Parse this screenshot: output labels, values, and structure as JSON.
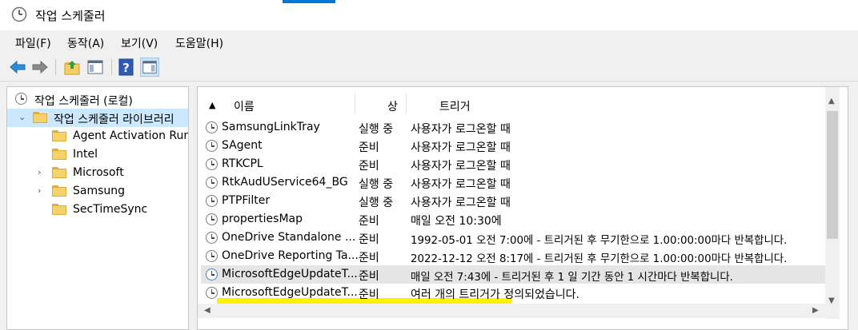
{
  "window": {
    "title": "작업 스케줄러"
  },
  "menu": [
    {
      "label": "파일(F)"
    },
    {
      "label": "동작(A)"
    },
    {
      "label": "보기(V)"
    },
    {
      "label": "도움말(H)"
    }
  ],
  "toolbar": {
    "buttons": [
      "back-arrow-icon",
      "forward-arrow-icon",
      "up-folder-icon",
      "show-hide-console-tree-icon",
      "help-icon",
      "show-hide-action-pane-icon"
    ]
  },
  "tree": {
    "root": "작업 스케줄러 (로컬)",
    "library": "작업 스케줄러 라이브러리",
    "folders": [
      {
        "label": "Agent Activation Runt"
      },
      {
        "label": "Intel"
      },
      {
        "label": "Microsoft"
      },
      {
        "label": "Samsung"
      },
      {
        "label": "SecTimeSync"
      }
    ]
  },
  "table": {
    "columns": {
      "name": "이름",
      "status": "상",
      "trigger": "트리거"
    },
    "rows": [
      {
        "name": "SamsungLinkTray",
        "status": "실행 중",
        "trigger": "사용자가 로그온할 때"
      },
      {
        "name": "SAgent",
        "status": "준비",
        "trigger": "사용자가 로그온할 때"
      },
      {
        "name": "RTKCPL",
        "status": "준비",
        "trigger": "사용자가 로그온할 때"
      },
      {
        "name": "RtkAudUService64_BG",
        "status": "실행 중",
        "trigger": "사용자가 로그온할 때"
      },
      {
        "name": "PTPFilter",
        "status": "실행 중",
        "trigger": "사용자가 로그온할 때"
      },
      {
        "name": "propertiesMap",
        "status": "준비",
        "trigger": "매일 오전 10:30에"
      },
      {
        "name": "OneDrive Standalone ...",
        "status": "준비",
        "trigger": "1992-05-01 오전 7:00에 - 트리거된 후 무기한으로 1.00:00:00마다 반복합니다."
      },
      {
        "name": "OneDrive Reporting Ta...",
        "status": "준비",
        "trigger": "2022-12-12 오전 8:17에 - 트리거된 후 무기한으로 1.00:00:00마다 반복합니다."
      },
      {
        "name": "MicrosoftEdgeUpdateT...",
        "status": "준비",
        "trigger": "매일 오전 7:43에 - 트리거된 후 1 일 기간 동안 1 시간마다 반복합니다."
      },
      {
        "name": "MicrosoftEdgeUpdateT...",
        "status": "준비",
        "trigger": "여러 개의 트리거가 정의되었습니다."
      }
    ]
  },
  "colors": {
    "highlight": "#fff200",
    "selection": "#cce8ff",
    "accent": "#0078d7"
  }
}
